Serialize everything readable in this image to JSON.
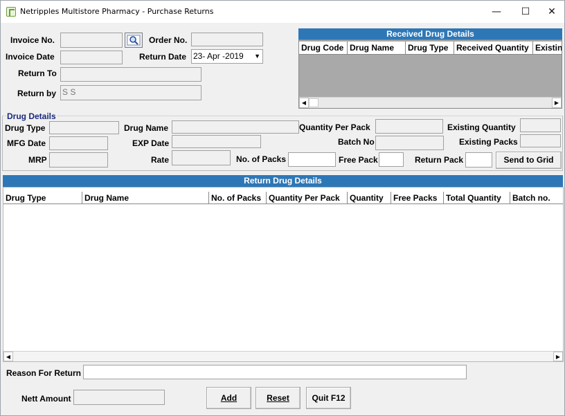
{
  "window": {
    "title": "Netripples Multistore Pharmacy - Purchase Returns",
    "minimize": "—",
    "maximize": "☐",
    "close": "✕"
  },
  "header_form": {
    "invoice_no_label": "Invoice No.",
    "invoice_no_value": "",
    "order_no_label": "Order No.",
    "order_no_value": "",
    "invoice_date_label": "Invoice Date",
    "invoice_date_value": "",
    "return_date_label": "Return Date",
    "return_date_value": "23- Apr -2019",
    "return_to_label": "Return To",
    "return_to_value": "",
    "return_by_label": "Return by",
    "return_by_value": "S S"
  },
  "received_grid": {
    "title": "Received Drug Details",
    "columns": [
      "Drug Code",
      "Drug Name",
      "Drug Type",
      "Received Quantity",
      "Existin"
    ]
  },
  "drug_details": {
    "group_label": "Drug Details",
    "drug_type_label": "Drug Type",
    "drug_name_label": "Drug Name",
    "qty_per_pack_label": "Quantity Per Pack",
    "existing_qty_label": "Existing Quantity",
    "mfg_date_label": "MFG Date",
    "exp_date_label": "EXP Date",
    "batch_no_label": "Batch No",
    "existing_packs_label": "Existing Packs",
    "mrp_label": "MRP",
    "rate_label": "Rate",
    "no_of_packs_label": "No. of Packs",
    "free_pack_label": "Free Pack",
    "return_pack_label": "Return Pack",
    "send_to_grid_label": "Send to Grid"
  },
  "return_grid": {
    "title": "Return Drug Details",
    "columns": [
      "Drug Type",
      "Drug Name",
      "No. of Packs",
      "Quantity Per Pack",
      "Quantity",
      "Free Packs",
      "Total Quantity",
      "Batch no."
    ]
  },
  "footer": {
    "reason_label": "Reason For Return",
    "reason_value": "",
    "nett_amount_label": "Nett Amount",
    "nett_amount_value": "",
    "add_label": "Add",
    "reset_label": "Reset",
    "quit_label": "Quit F12"
  },
  "colors": {
    "header_blue": "#2e77b6",
    "grid_empty_gray": "#a9a9a9"
  }
}
